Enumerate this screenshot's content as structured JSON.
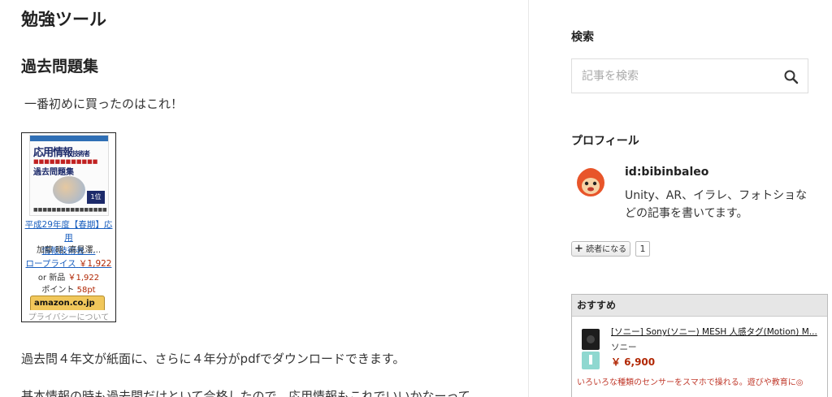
{
  "main": {
    "blog_title": "勉強ツール",
    "section_title": "過去問題集",
    "intro": "一番初めに買ったのはこれ！",
    "product": {
      "cover": {
        "title": "応用情報",
        "sub": "技術者",
        "title2": "過去問題集",
        "badge": "1位"
      },
      "title_line1": "平成29年度【春期】応用",
      "title_line2": "情報技術者 ...",
      "author": "加藤 昭, 高見澤...",
      "list_label": "ロープライス",
      "list_price": "￥1,922",
      "new_label": "or 新品",
      "new_price": "￥1,922",
      "point_label": "ポイント",
      "point_value": "58pt",
      "amazon_button": "amazon.co.jp",
      "privacy_label": "プライバシーについて"
    },
    "para2": "過去問４年文が紙面に、さらに４年分がpdfでダウンロードできます。",
    "para3": "基本情報の時も過去問だけといて合格したので、応用情報もこれでいいかなーって"
  },
  "sidebar": {
    "search": {
      "heading": "検索",
      "placeholder": "記事を検索",
      "icon": "search-icon"
    },
    "profile": {
      "heading": "プロフィール",
      "id": "id:bibinbaleo",
      "description": "Unity、AR、イラレ、フォトショなどの記事を書いてます。",
      "subscribe_label": "読者になる",
      "subscriber_count": "1"
    },
    "recommend": {
      "heading": "おすすめ",
      "title": "[ソニー] Sony(ソニー) MESH 人感タグ(Motion) M...",
      "maker": "ソニー",
      "price": "￥ 6,900",
      "description": "いろいろな種類のセンサーをスマホで操れる。遊びや教育に◎"
    }
  },
  "colors": {
    "link": "#1a5fbf",
    "price": "#b12704"
  }
}
